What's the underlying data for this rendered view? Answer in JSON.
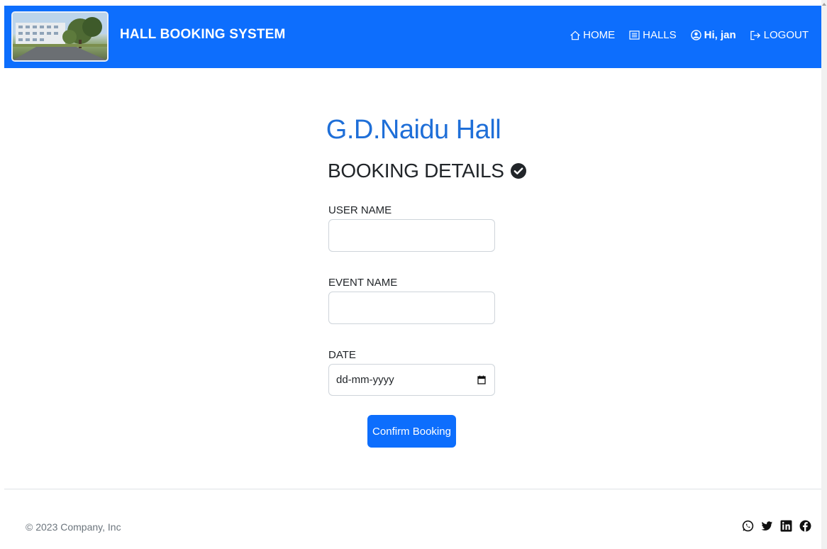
{
  "theme": {
    "brand": "#0d6efd",
    "accent": "#1f6fd8"
  },
  "header": {
    "brand_title": "HALL BOOKING SYSTEM",
    "logo_icon": "campus-building-photo",
    "nav": [
      {
        "label": "HOME",
        "icon": "home-icon"
      },
      {
        "label": "HALLS",
        "icon": "list-icon"
      },
      {
        "label": "Hi, jan",
        "icon": "user-circle-icon"
      },
      {
        "label": "LOGOUT",
        "icon": "logout-icon"
      }
    ]
  },
  "main": {
    "hall_name": "G.D.Naidu Hall",
    "section_title": "BOOKING DETAILS",
    "section_icon": "check-circle-icon",
    "form": {
      "user_name_label": "USER NAME",
      "user_name_value": "",
      "event_name_label": "EVENT NAME",
      "event_name_value": "",
      "date_label": "DATE",
      "date_placeholder": "dd-mm-yyyy",
      "date_icon": "calendar-icon",
      "confirm_label": "Confirm Booking"
    }
  },
  "footer": {
    "copyright": "© 2023 Company, Inc",
    "social": [
      "whatsapp-icon",
      "twitter-icon",
      "linkedin-icon",
      "facebook-icon"
    ]
  }
}
